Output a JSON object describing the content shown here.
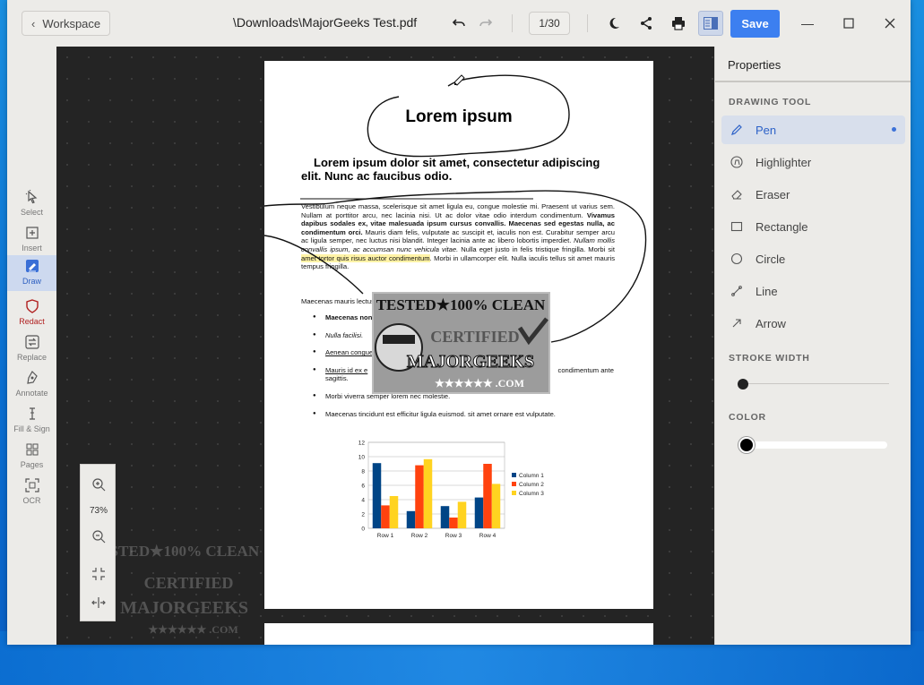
{
  "titlebar": {
    "workspace_label": "Workspace",
    "doc_title": "\\Downloads\\MajorGeeks Test.pdf",
    "page_indicator": "1/30",
    "save_label": "Save"
  },
  "rail": {
    "select": "Select",
    "insert": "Insert",
    "draw": "Draw",
    "redact": "Redact",
    "replace": "Replace",
    "annotate": "Annotate",
    "fill_sign": "Fill & Sign",
    "pages": "Pages",
    "ocr": "OCR"
  },
  "zoom": {
    "level": "73%"
  },
  "document": {
    "heading": "Lorem ipsum",
    "subheading_line1": "Lorem ipsum dolor sit amet, consectetur adipiscing",
    "subheading_line2": "elit. Nunc ac faucibus odio.",
    "para_a": "Vestibulum neque massa, scelerisque sit amet ligula eu, congue molestie mi. Praesent ut varius sem. Nullam at porttitor arcu, nec lacinia nisi. Ut ac dolor vitae odio interdum condimentum. ",
    "para_bold": "Vivamus dapibus sodales ex, vitae malesuada ipsum cursus convallis. Maecenas sed egestas nulla, ac condimentum orci.",
    "para_b": " Mauris diam felis, vulputate ac suscipit et, iaculis non est. Curabitur semper arcu ac ligula semper, nec luctus nisi blandit. Integer lacinia ante ac libero lobortis imperdiet. ",
    "para_italic": "Nullam mollis convallis ipsum, ac accumsan nunc vehicula vitae.",
    "para_c": " Nulla eget justo in felis tristique fringilla. Morbi sit ",
    "para_highlight": "amet tortor quis risus auctor condimentum",
    "para_d": ". Morbi in ullamcorper elit. Nulla iaculis tellus sit amet mauris tempus fringilla.",
    "mauris_line": "Maecenas mauris lectus",
    "list": {
      "item1": "Maecenas non",
      "item2": "Nulla facilisi.",
      "item3": "Aenean congue",
      "item4a": "Mauris id ex e",
      "item4b": "condimentum ante",
      "item4c": "sagittis.",
      "item5": "Morbi viverra semper lorem nec molestie.",
      "item6": "Maecenas tincidunt est efficitur ligula euismod. sit amet ornare est vulputate."
    },
    "badge": {
      "line1": "TESTED★100% CLEAN",
      "line2": "CERTIFIED",
      "line3": "MAJORGEEKS",
      "line4": "★★★★★★ .COM"
    }
  },
  "chart_data": {
    "type": "bar",
    "categories": [
      "Row 1",
      "Row 2",
      "Row 3",
      "Row 4"
    ],
    "series": [
      {
        "name": "Column 1",
        "values": [
          9.1,
          2.4,
          3.1,
          4.3
        ],
        "color": "#004586"
      },
      {
        "name": "Column 2",
        "values": [
          3.2,
          8.8,
          1.5,
          9.0
        ],
        "color": "#ff420e"
      },
      {
        "name": "Column 3",
        "values": [
          4.5,
          9.65,
          3.7,
          6.2
        ],
        "color": "#ffd320"
      }
    ],
    "ylim": [
      0,
      12
    ],
    "yticks": [
      "0",
      "2",
      "4",
      "6",
      "8",
      "10",
      "12"
    ],
    "grid": true,
    "legend": "right"
  },
  "props": {
    "title": "Properties",
    "drawing_tool_label": "DRAWING TOOL",
    "tools": [
      "Pen",
      "Highlighter",
      "Eraser",
      "Rectangle",
      "Circle",
      "Line",
      "Arrow"
    ],
    "stroke_label": "STROKE WIDTH",
    "stroke_value": 0.0,
    "color_label": "COLOR",
    "color_value": "#000000",
    "active_color": "#2d62c8"
  }
}
